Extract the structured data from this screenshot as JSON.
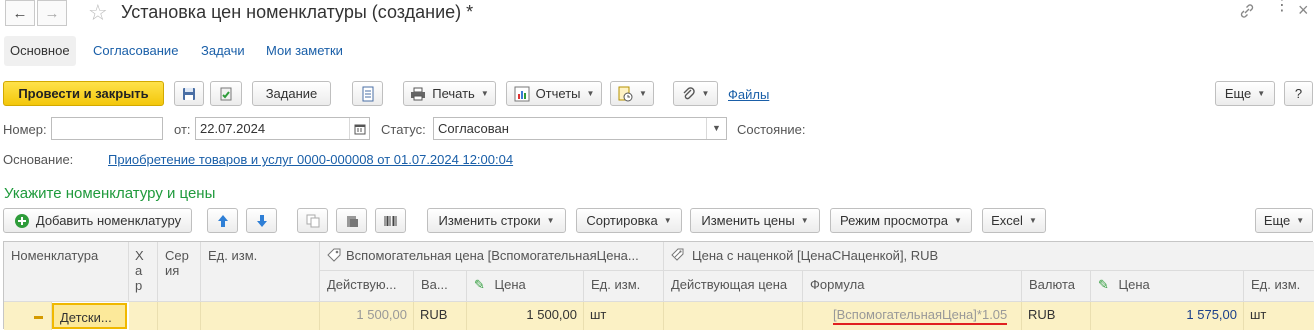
{
  "window": {
    "title": "Установка цен номенклатуры (создание) *"
  },
  "tabs": [
    {
      "label": "Основное",
      "active": true
    },
    {
      "label": "Согласование"
    },
    {
      "label": "Задачи"
    },
    {
      "label": "Мои заметки"
    }
  ],
  "toolbar": {
    "post_close": "Провести и закрыть",
    "task": "Задание",
    "print": "Печать",
    "reports": "Отчеты",
    "files": "Файлы",
    "more": "Еще",
    "help": "?"
  },
  "form": {
    "number_label": "Номер:",
    "number_value": "",
    "date_label": "от:",
    "date_value": "22.07.2024",
    "status_label": "Статус:",
    "status_value": "Согласован",
    "state_label": "Состояние:",
    "basis_label": "Основание:",
    "basis_link": "Приобретение товаров и услуг 0000-000008 от 01.07.2024 12:00:04"
  },
  "section": {
    "title": "Укажите номенклатуру и цены"
  },
  "table_toolbar": {
    "add_item": "Добавить номенклатуру",
    "change_rows": "Изменить строки",
    "sorting": "Сортировка",
    "change_prices": "Изменить цены",
    "view_mode": "Режим просмотра",
    "excel": "Excel",
    "more": "Еще"
  },
  "table": {
    "headers": {
      "item": "Номенклатура",
      "char": "Х а р",
      "series": "Сер ия",
      "unit": "Ед. изм.",
      "aux_group": "Вспомогательная цена [ВспомогательнаяЦена...",
      "markup_group": "Цена с наценкой  [ЦенаСНаценкой], RUB",
      "aux_current": "Действую...",
      "aux_currency": "Ва...",
      "aux_price": "Цена",
      "aux_unit": "Ед. изм.",
      "mk_current": "Действующая цена",
      "mk_formula": "Формула",
      "mk_currency": "Валюта",
      "mk_price": "Цена",
      "mk_unit": "Ед. изм."
    },
    "rows": [
      {
        "item": "Детски...",
        "aux_current": "1 500,00",
        "aux_currency": "RUB",
        "aux_price": "1 500,00",
        "aux_unit": "шт",
        "mk_current": "",
        "mk_formula": "[ВспомогательнаяЦена]*1.05",
        "mk_currency": "RUB",
        "mk_price": "1 575,00",
        "mk_unit": "шт"
      }
    ]
  },
  "colors": {
    "primary": "#f3c70b",
    "link": "#1a5fa8",
    "section_title": "#1f9a3c",
    "row_selected": "#fbf1c5",
    "formula_underline": "#e02020"
  }
}
